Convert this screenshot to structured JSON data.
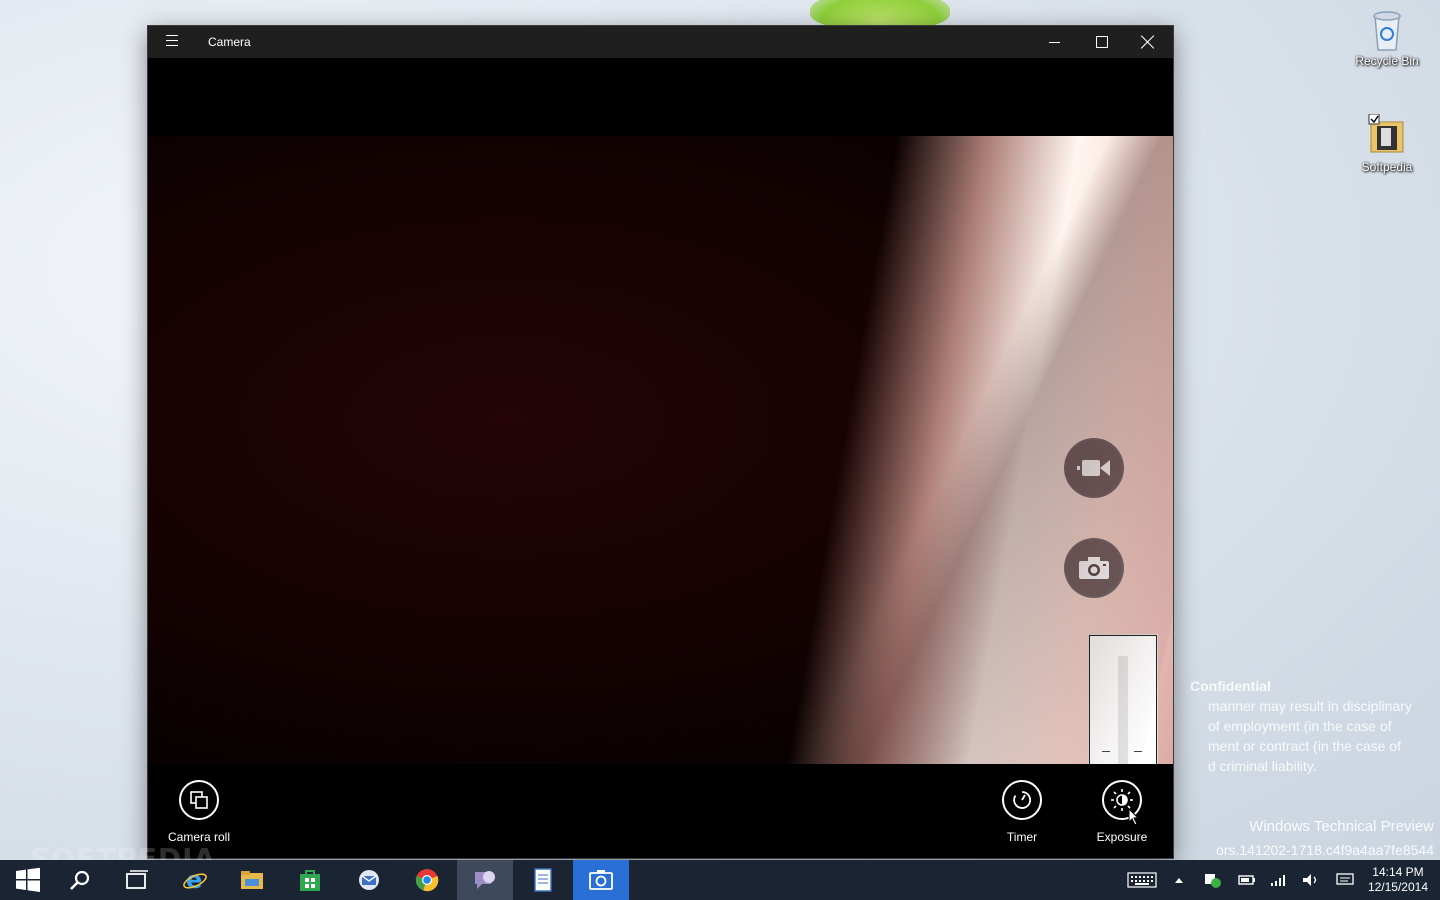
{
  "window": {
    "title": "Camera",
    "controls": {
      "minimize": "minimize",
      "maximize": "maximize",
      "close": "close"
    }
  },
  "camera": {
    "modes": {
      "video_icon": "video-camera-icon",
      "photo_icon": "camera-icon"
    },
    "exposure_level": 0.3,
    "tools": {
      "camera_roll": "Camera roll",
      "timer": "Timer",
      "exposure": "Exposure"
    }
  },
  "desktop": {
    "icons": [
      {
        "label": "Recycle Bin",
        "icon": "recycle-bin-icon"
      },
      {
        "label": "Softpedia",
        "icon": "folder-icon"
      }
    ],
    "notice": {
      "heading": "Confidential",
      "lines": [
        "manner may result in disciplinary",
        "of employment (in the case of",
        "ment or contract (in the case of",
        "d criminal liability."
      ]
    },
    "build_info": {
      "line1": "Windows Technical Preview",
      "line2": "ors.141202-1718.c4f9a4aa7fe8544"
    }
  },
  "taskbar": {
    "apps": [
      "start",
      "search",
      "task-view",
      "internet-explorer",
      "file-explorer",
      "store",
      "outlook",
      "chrome",
      "feedback",
      "notepad",
      "camera"
    ],
    "clock": {
      "time": "14:14 PM",
      "date": "12/15/2014"
    }
  },
  "watermark": "SOFTPEDIA"
}
